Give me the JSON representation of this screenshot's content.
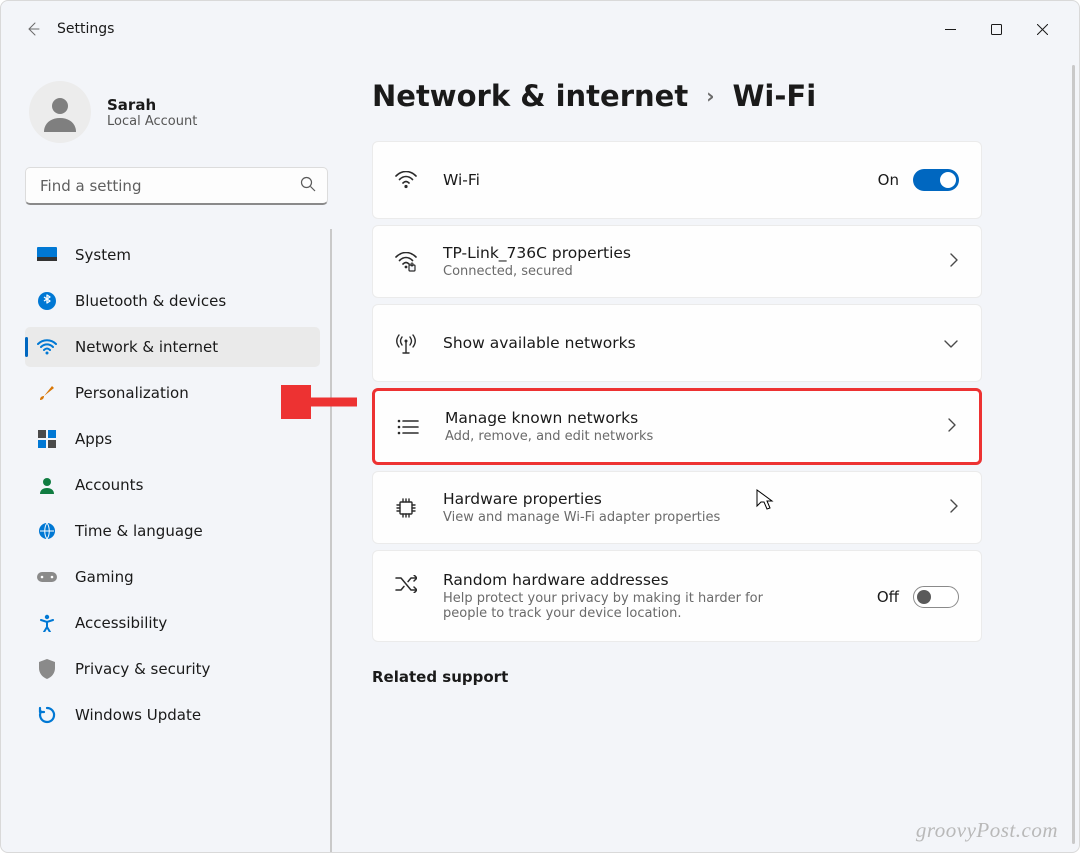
{
  "window": {
    "title": "Settings"
  },
  "account": {
    "name": "Sarah",
    "sub": "Local Account"
  },
  "search": {
    "placeholder": "Find a setting"
  },
  "nav": [
    {
      "id": "system",
      "label": "System",
      "icon": "system"
    },
    {
      "id": "bluetooth",
      "label": "Bluetooth & devices",
      "icon": "bluetooth"
    },
    {
      "id": "network",
      "label": "Network & internet",
      "icon": "wifi",
      "active": true
    },
    {
      "id": "personal",
      "label": "Personalization",
      "icon": "brush"
    },
    {
      "id": "apps",
      "label": "Apps",
      "icon": "apps"
    },
    {
      "id": "accounts",
      "label": "Accounts",
      "icon": "person"
    },
    {
      "id": "time",
      "label": "Time & language",
      "icon": "globe"
    },
    {
      "id": "gaming",
      "label": "Gaming",
      "icon": "gamepad"
    },
    {
      "id": "access",
      "label": "Accessibility",
      "icon": "access"
    },
    {
      "id": "privacy",
      "label": "Privacy & security",
      "icon": "shield"
    },
    {
      "id": "update",
      "label": "Windows Update",
      "icon": "update"
    }
  ],
  "breadcrumb": {
    "parent": "Network & internet",
    "current": "Wi-Fi"
  },
  "cards": {
    "wifi": {
      "title": "Wi-Fi",
      "state": "On"
    },
    "props": {
      "title": "TP-Link_736C properties",
      "sub": "Connected, secured"
    },
    "avail": {
      "title": "Show available networks"
    },
    "known": {
      "title": "Manage known networks",
      "sub": "Add, remove, and edit networks"
    },
    "hw": {
      "title": "Hardware properties",
      "sub": "View and manage Wi-Fi adapter properties"
    },
    "random": {
      "title": "Random hardware addresses",
      "sub": "Help protect your privacy by making it harder for people to track your device location.",
      "state": "Off"
    }
  },
  "related": {
    "heading": "Related support"
  },
  "watermark": "groovyPost.com"
}
